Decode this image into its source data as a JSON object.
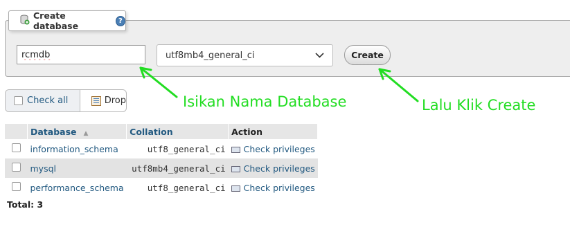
{
  "create_db": {
    "legend": "Create database",
    "db_name_value": "rcmdb",
    "collation_value": "utf8mb4_general_ci",
    "create_label": "Create"
  },
  "actions": {
    "check_all_label": "Check all",
    "drop_label": "Drop"
  },
  "table": {
    "headers": {
      "database": "Database",
      "collation": "Collation",
      "action": "Action"
    },
    "rows": [
      {
        "name": "information_schema",
        "collation": "utf8_general_ci",
        "action": "Check privileges"
      },
      {
        "name": "mysql",
        "collation": "utf8mb4_general_ci",
        "action": "Check privileges"
      },
      {
        "name": "performance_schema",
        "collation": "utf8_general_ci",
        "action": "Check privileges"
      }
    ],
    "total": "Total: 3"
  },
  "annotations": {
    "name_hint": "Isikan Nama Database",
    "create_hint": "Lalu Klik Create",
    "color": "#22dd22"
  }
}
